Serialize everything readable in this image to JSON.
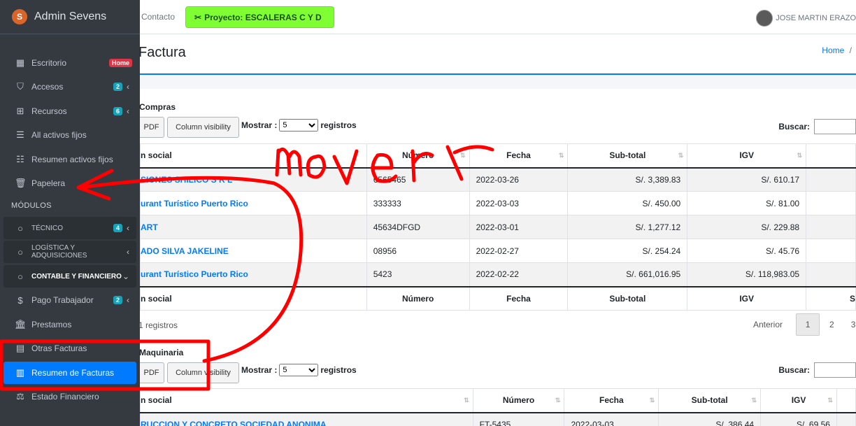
{
  "brand": {
    "name": "Admin Sevens",
    "logo_letter": "S"
  },
  "sidebar": {
    "items": [
      {
        "icon": "dashboard-grid-icon",
        "glyph": "▦",
        "label": "Escritorio",
        "badge": "Home"
      },
      {
        "icon": "shield-icon",
        "glyph": "⛉",
        "label": "Accesos",
        "badge": "2"
      },
      {
        "icon": "sitemap-icon",
        "glyph": "⊞",
        "label": "Recursos",
        "badge": "6"
      },
      {
        "icon": "list-icon",
        "glyph": "☰",
        "label": "All activos fijos"
      },
      {
        "icon": "list-check-icon",
        "glyph": "☷",
        "label": "Resumen activos fijos"
      },
      {
        "icon": "trash-icon",
        "glyph": "🗑",
        "label": "Papelera"
      }
    ],
    "section_header": "MÓDULOS",
    "modules": [
      {
        "label": "TÉCNICO",
        "badge": "4"
      },
      {
        "label": "LOGÍSTICA Y ADQUISICIONES"
      },
      {
        "label": "CONTABLE Y FINANCIERO"
      }
    ],
    "sub_items": [
      {
        "icon": "dollar-icon",
        "glyph": "$",
        "label": "Pago Trabajador",
        "badge": "2"
      },
      {
        "icon": "bank-icon",
        "glyph": "🏛",
        "label": "Prestamos"
      },
      {
        "icon": "invoice-icon",
        "glyph": "▤",
        "label": "Otras Facturas"
      },
      {
        "icon": "chart-icon",
        "glyph": "▥",
        "label": "Resumen de Facturas"
      },
      {
        "icon": "balance-icon",
        "glyph": "⚖",
        "label": "Estado Financiero"
      }
    ]
  },
  "topbar": {
    "contacto": "Contacto",
    "proyecto": "Proyecto: ESCALERAS C Y D",
    "user": "JOSE MARTIN ERAZO"
  },
  "header": {
    "title": "Factura",
    "breadcrumb_home": "Home",
    "breadcrumb_sep": "/"
  },
  "compras": {
    "title": "Compras",
    "pdf": "PDF",
    "colvis": "Column visibility",
    "mostrar_label": "Mostrar :",
    "mostrar_value": "5",
    "registros_label": "registros",
    "buscar_label": "Buscar:",
    "columns": [
      "n social",
      "Número",
      "Fecha",
      "Sub-total",
      "IGV"
    ],
    "footer_columns": [
      "n social",
      "Número",
      "Fecha",
      "Sub-total",
      "IGV",
      "S"
    ],
    "rows": [
      {
        "name": "SIONES SHILICO S R L",
        "numero": "6565465",
        "fecha": "2022-03-26",
        "subtotal": "S/. 3,389.83",
        "igv": "S/. 610.17"
      },
      {
        "name": "urant Turístico Puerto Rico",
        "numero": "333333",
        "fecha": "2022-03-03",
        "subtotal": "S/. 450.00",
        "igv": "S/. 81.00"
      },
      {
        "name": "ART",
        "numero": "45634DFGD",
        "fecha": "2022-03-01",
        "subtotal": "S/. 1,277.12",
        "igv": "S/. 229.88"
      },
      {
        "name": "ADO SILVA JAKELINE",
        "numero": "08956",
        "fecha": "2022-02-27",
        "subtotal": "S/. 254.24",
        "igv": "S/. 45.76"
      },
      {
        "name": "urant Turístico Puerto Rico",
        "numero": "5423",
        "fecha": "2022-02-22",
        "subtotal": "S/. 661,016.95",
        "igv": "S/. 118,983.05"
      }
    ],
    "info": "1 registros",
    "prev": "Anterior",
    "pages": [
      "1",
      "2",
      "3"
    ]
  },
  "maquinaria": {
    "title": "Maquinaria",
    "pdf": "PDF",
    "colvis": "Column visibility",
    "mostrar_label": "Mostrar :",
    "mostrar_value": "5",
    "registros_label": "registros",
    "buscar_label": "Buscar:",
    "columns": [
      "n social",
      "Número",
      "Fecha",
      "Sub-total",
      "IGV"
    ],
    "rows": [
      {
        "name": "RUCCION Y CONCRETO SOCIEDAD ANONIMA",
        "numero": "FT-5435",
        "fecha": "2022-03-03",
        "subtotal": "S/. 386.44",
        "igv": "S/. 69.56"
      }
    ]
  },
  "annotation": {
    "text": "mover",
    "color": "#ff0000"
  }
}
